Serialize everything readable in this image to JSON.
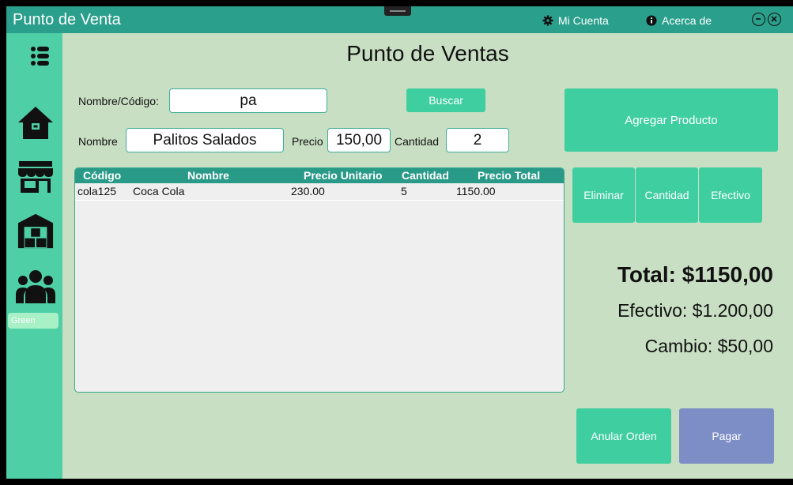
{
  "window": {
    "title": "Punto de Venta"
  },
  "titlebar": {
    "account_label": "Mi Cuenta",
    "about_label": "Acerca de"
  },
  "sidebar": {
    "theme_label": "Green"
  },
  "main": {
    "page_title": "Punto de Ventas",
    "search": {
      "label": "Nombre/Código:",
      "value": "pa",
      "button_label": "Buscar"
    },
    "product": {
      "name_label": "Nombre",
      "name_value": "Palitos Salados",
      "price_label": "Precio",
      "price_value": "150,00",
      "qty_label": "Cantidad",
      "qty_value": "2"
    },
    "add_button_label": "Agregar Producto",
    "table": {
      "headers": [
        "Código",
        "Nombre",
        "Precio Unitario",
        "Cantidad",
        "Precio Total"
      ],
      "rows": [
        [
          "cola125",
          "Coca Cola",
          "230.00",
          "5",
          "1150.00"
        ]
      ]
    },
    "actions": {
      "delete_label": "Eliminar",
      "quantity_label": "Cantidad",
      "cash_label": "Efectivo"
    },
    "totals": {
      "total": "Total: $1150,00",
      "cash": "Efectivo: $1.200,00",
      "change": "Cambio: $50,00"
    },
    "footer": {
      "cancel_label": "Anular Orden",
      "pay_label": "Pagar"
    }
  },
  "colors": {
    "titlebar": "#2a9f8c",
    "sidebar": "#4ecfa5",
    "background": "#c9dfc4",
    "accent": "#3fcea0",
    "pay": "#7d8ec6",
    "grid_header": "#2a9a88"
  }
}
